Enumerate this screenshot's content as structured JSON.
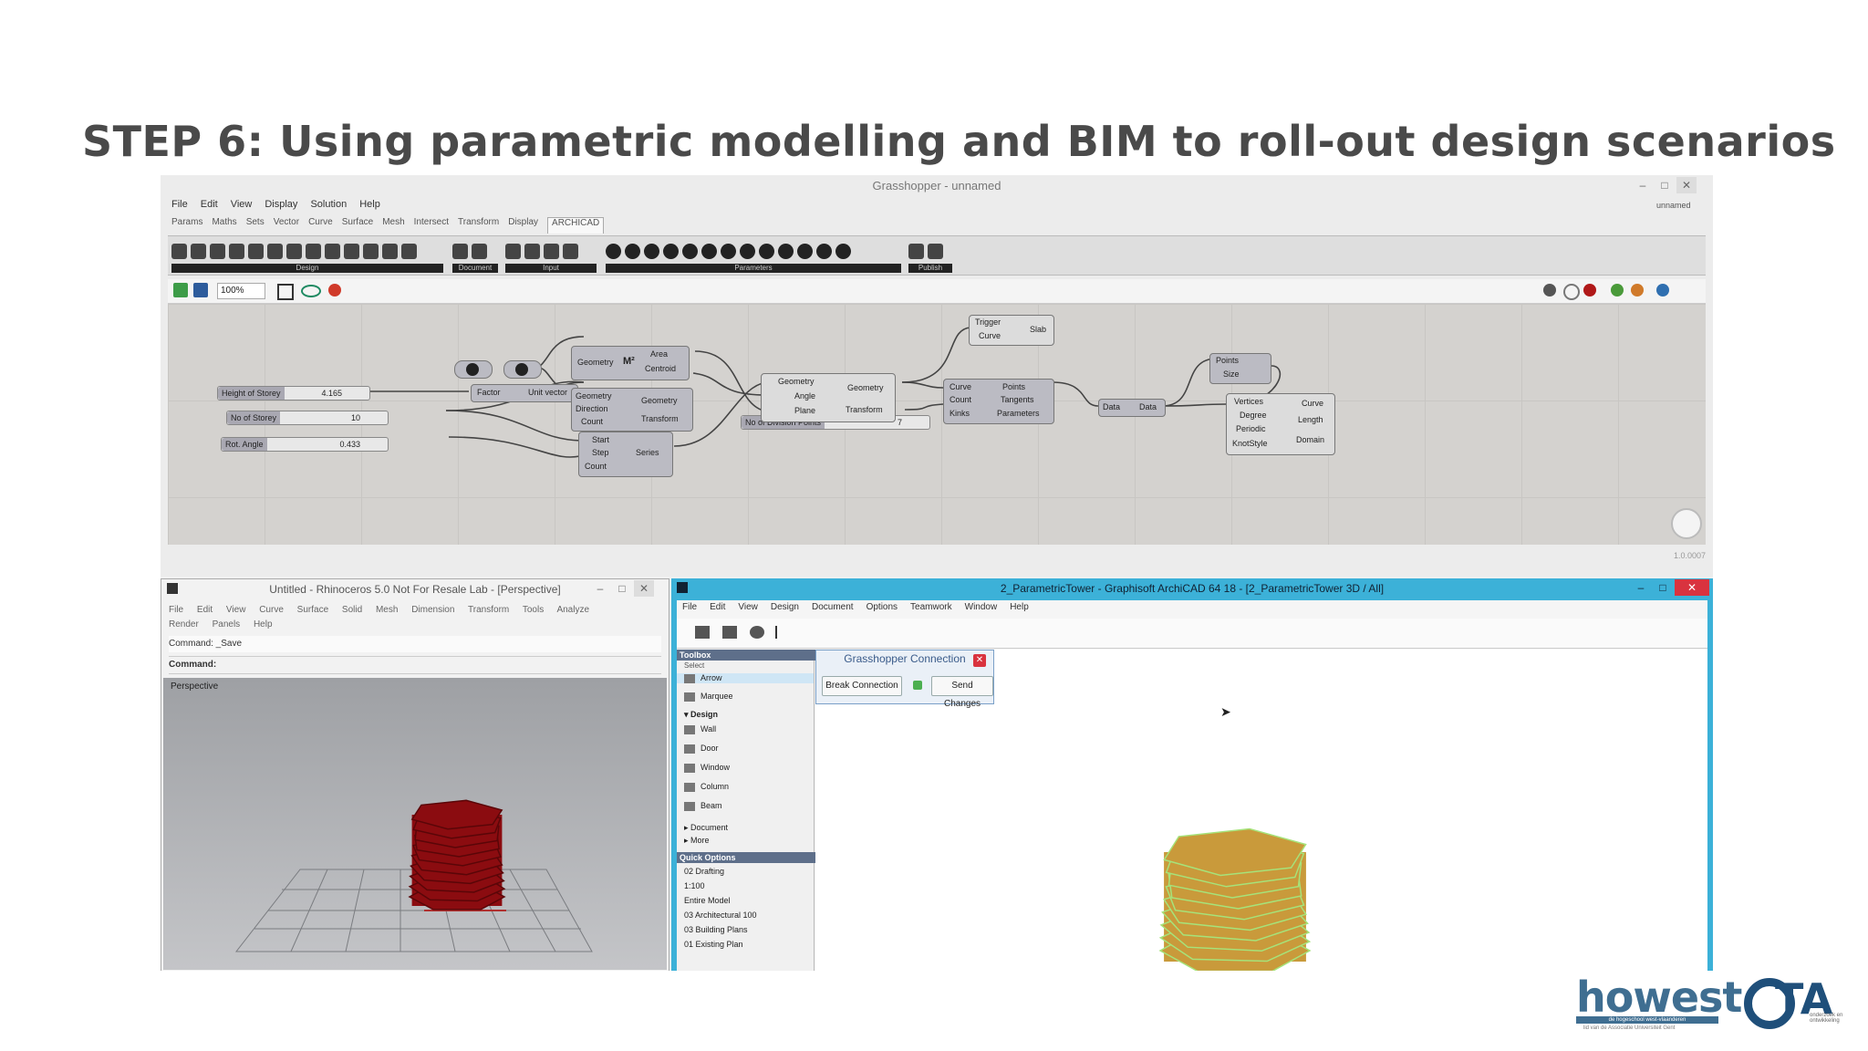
{
  "slide": {
    "title": "STEP 6: Using parametric modelling and BIM to roll-out design scenarios"
  },
  "grasshopper": {
    "window_title": "Grasshopper - unnamed",
    "doc_name": "unnamed",
    "menu": [
      "File",
      "Edit",
      "View",
      "Display",
      "Solution",
      "Help"
    ],
    "tabs": [
      "Params",
      "Maths",
      "Sets",
      "Vector",
      "Curve",
      "Surface",
      "Mesh",
      "Intersect",
      "Transform",
      "Display",
      "ARCHICAD"
    ],
    "active_tab": "ARCHICAD",
    "toolbar_groups": [
      "Design",
      "Document",
      "Input",
      "Parameters",
      "Publish"
    ],
    "zoom": "100%",
    "components": {
      "area": {
        "in": "Geometry",
        "icon": "M²",
        "out1": "Area",
        "out2": "Centroid"
      },
      "move": {
        "in1": "Geometry",
        "in2": "Direction",
        "in3": "Count",
        "out1": "Geometry",
        "out2": "Transform"
      },
      "vector": {
        "in": "Factor",
        "out": "Unit vector"
      },
      "series": {
        "in1": "Start",
        "in2": "Step",
        "in3": "Count",
        "out": "Series"
      },
      "rotate": {
        "in1": "Geometry",
        "in2": "Angle",
        "in3": "Plane",
        "out1": "Geometry",
        "out2": "Transform"
      },
      "trigger": {
        "in1": "Trigger",
        "in2": "Curve",
        "out": "Slab"
      },
      "divide": {
        "in1": "Curve",
        "in2": "Count",
        "in3": "Kinks",
        "out1": "Points",
        "out2": "Tangents",
        "out3": "Parameters"
      },
      "data": {
        "in": "Data",
        "out": "Data"
      },
      "points": {
        "in1": "Points",
        "in2": "Size"
      },
      "nurbs": {
        "in1": "Vertices",
        "in2": "Degree",
        "in3": "Periodic",
        "in4": "KnotStyle",
        "out1": "Curve",
        "out2": "Length",
        "out3": "Domain"
      }
    },
    "sliders": [
      {
        "name": "Height of Storey",
        "value": "4.165"
      },
      {
        "name": "No of Storey",
        "value": "10"
      },
      {
        "name": "Rot. Angle",
        "value": "0.433"
      },
      {
        "name": "No of Division Points",
        "value": "7"
      }
    ],
    "status": "1.0.0007"
  },
  "rhino": {
    "window_title": "Untitled - Rhinoceros 5.0 Not For Resale Lab - [Perspective]",
    "menu": [
      "File",
      "Edit",
      "View",
      "Curve",
      "Surface",
      "Solid",
      "Mesh",
      "Dimension",
      "Transform",
      "Tools",
      "Analyze",
      "Render",
      "Panels",
      "Help"
    ],
    "command_history": "Command: _Save",
    "command_prompt": "Command:",
    "viewport": "Perspective",
    "model_color": "#8b0c10"
  },
  "archicad": {
    "window_title": "2_ParametricTower - Graphisoft ArchiCAD 64 18 - [2_ParametricTower 3D / All]",
    "menu": [
      "File",
      "Edit",
      "View",
      "Design",
      "Document",
      "Options",
      "Teamwork",
      "Window",
      "Help"
    ],
    "toolbox_title": "Toolbox",
    "toolbox_select": "Select",
    "toolbox_items": [
      "Arrow",
      "Marquee"
    ],
    "design_header": "Design",
    "design_items": [
      "Wall",
      "Door",
      "Window",
      "Column",
      "Beam"
    ],
    "more_items": [
      "Document",
      "More"
    ],
    "quick_options_title": "Quick Options",
    "quick_options": [
      "02 Drafting",
      "1:100",
      "Entire Model",
      "03 Architectural 100",
      "03 Building Plans",
      "01 Existing Plan"
    ],
    "gc_title": "Grasshopper Connection",
    "gc_break": "Break Connection",
    "gc_send": "Send Changes",
    "model_color": "#c99a3b",
    "model_edge": "#a6e37a",
    "accent": "#3cb1d8"
  },
  "logos": {
    "howest": "howest",
    "howest_tagline": "de hogeschool west-vlaanderen",
    "howest_sub": "lid van de Associatie Universiteit Gent",
    "ota": "TA",
    "ota_sub": "onderzoek en ontwikkeling"
  }
}
